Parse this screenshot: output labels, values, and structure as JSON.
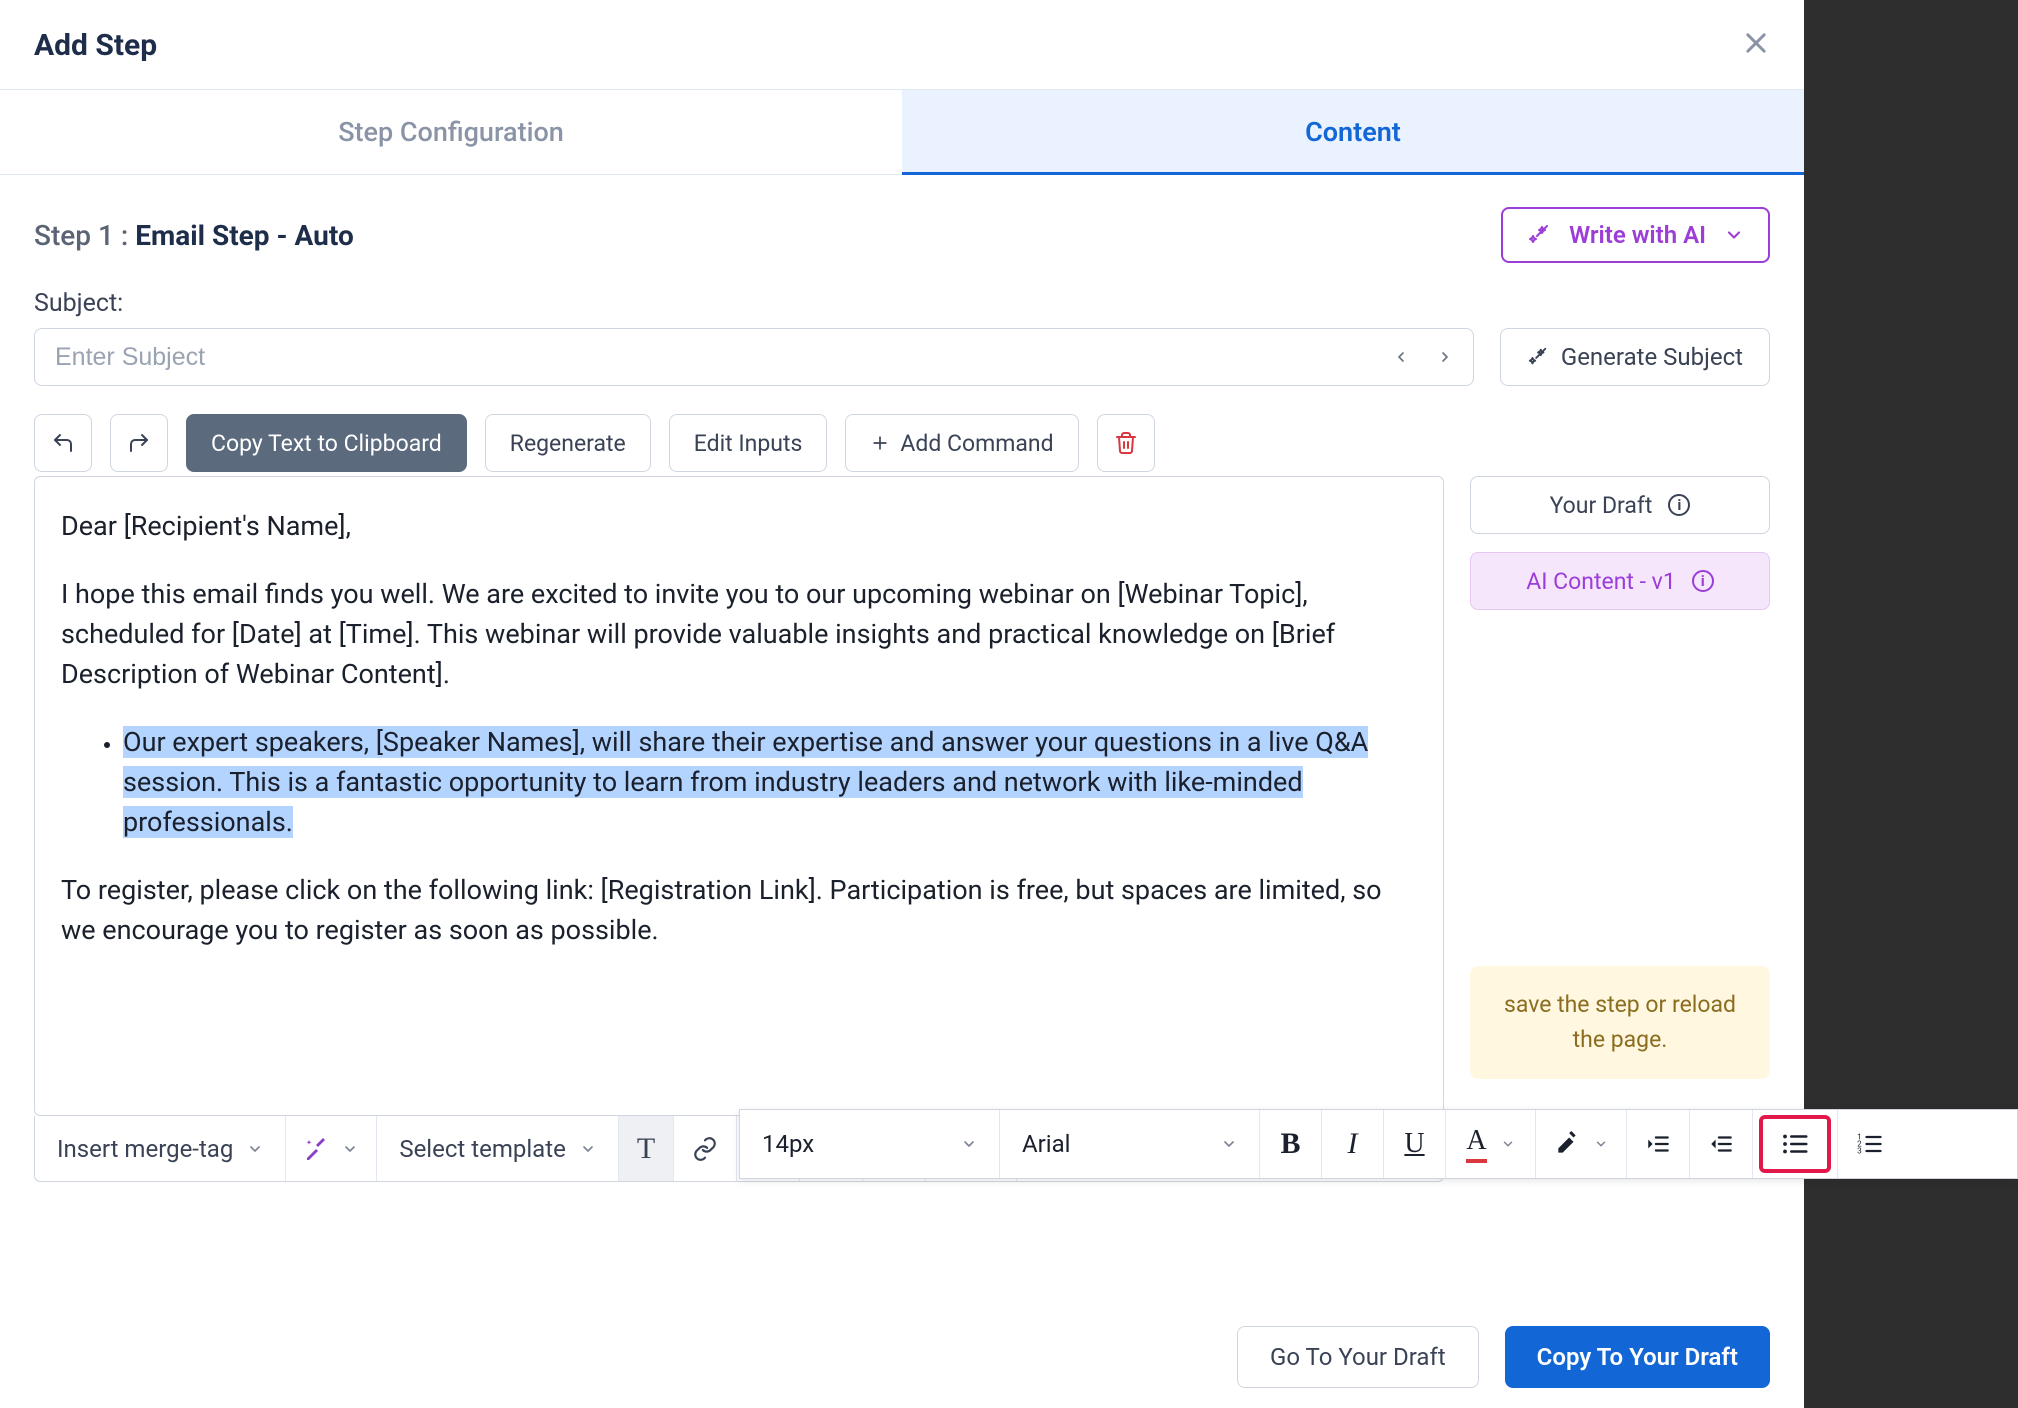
{
  "modal": {
    "title": "Add Step",
    "tabs": {
      "config": "Step Configuration",
      "content": "Content"
    },
    "step_prefix": "Step 1 :",
    "step_name": "Email Step - Auto",
    "write_ai": "Write with AI",
    "subject_label": "Subject:",
    "subject_placeholder": "Enter Subject",
    "generate_subject": "Generate Subject",
    "buttons": {
      "copy": "Copy Text to Clipboard",
      "regenerate": "Regenerate",
      "edit_inputs": "Edit Inputs",
      "add_command": "Add Command"
    },
    "email": {
      "greeting": "Dear [Recipient's Name],",
      "intro": "I hope this email finds you well. We are excited to invite you to our upcoming webinar on [Webinar Topic], scheduled for [Date] at [Time]. This webinar will provide valuable insights and practical knowledge on [Brief Description of Webinar Content].",
      "bullet": "Our expert speakers, [Speaker Names], will share their expertise and answer your questions in a live Q&A session. This is a fantastic opportunity to learn from industry leaders and network with like-minded professionals.",
      "register": "To register, please click on the following link: [Registration Link]. Participation is free, but spaces are limited, so we encourage you to register as soon as possible."
    },
    "right": {
      "your_draft": "Your Draft",
      "ai_content": "AI Content - v1",
      "save_hint": "save the step or reload the page."
    },
    "bottom_toolbar": {
      "merge_tag": "Insert merge-tag",
      "template": "Select template"
    },
    "float_toolbar": {
      "font_size": "14px",
      "font_family": "Arial",
      "bold": "B",
      "italic": "I",
      "underline": "U",
      "text_color": "A"
    },
    "footer": {
      "go_draft": "Go To Your Draft",
      "copy_draft": "Copy To Your Draft"
    }
  }
}
